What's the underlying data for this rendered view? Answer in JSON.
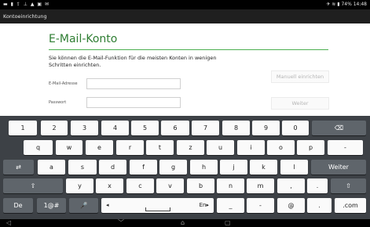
{
  "statusbar": {
    "left_icons": "▬ ▮ ⇪ ⊥ ▲ ▣ ✉",
    "right": "✈ ≋ ▮ 74% 14:48"
  },
  "actionbar": {
    "title": "Kontoeinrichtung"
  },
  "form": {
    "heading": "E-Mail-Konto",
    "description": "Sie können die E-Mail-Funktion für die meisten Konten in wenigen Schritten einrichten.",
    "email_label": "E-Mail-Adresse",
    "email_value": "",
    "password_label": "Passwort",
    "password_value": "",
    "manual_setup_label": "Manuell einrichten",
    "next_label": "Weiter"
  },
  "keyboard": {
    "row1": [
      "1",
      "2",
      "3",
      "4",
      "5",
      "6",
      "7",
      "8",
      "9",
      "0"
    ],
    "row1_backspace": "⌫",
    "row2": [
      "q",
      "w",
      "e",
      "r",
      "t",
      "z",
      "u",
      "i",
      "o",
      "p",
      "-"
    ],
    "row3_tab": "⇄",
    "row3": [
      "a",
      "s",
      "d",
      "f",
      "g",
      "h",
      "j",
      "k",
      "l"
    ],
    "row3_enter": "Weiter",
    "shift": "⇧",
    "row4": [
      "y",
      "x",
      "c",
      "v",
      "b",
      "n",
      "m",
      ",",
      "."
    ],
    "lang": "De",
    "symbols": "1@#",
    "mic": "🎤",
    "space_left": "◂",
    "space_right": "En▸",
    "underscore": "_",
    "dash": "-",
    "at": "@",
    "dot": ".",
    "dotcom": ".com"
  },
  "navbar": {
    "back": "◁",
    "down": "﹀",
    "home": "⌂",
    "recent": "▢"
  },
  "colors": {
    "accent": "#2e7d32",
    "keyboard_bg": "#3d4146",
    "key": "#fafafa",
    "key_dark": "#5f656b"
  }
}
